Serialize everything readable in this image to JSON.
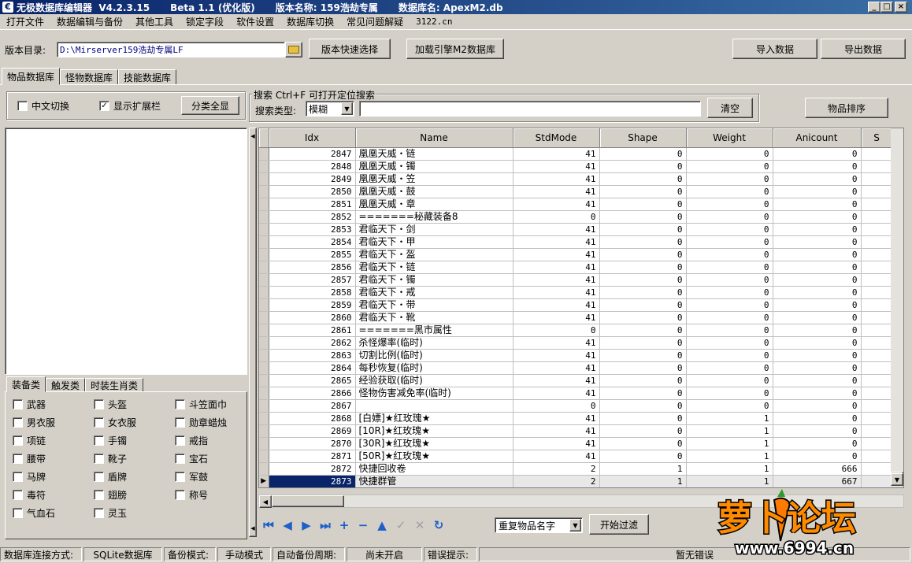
{
  "window": {
    "app_title": "无极数据库编辑器",
    "version": "V4.2.3.15",
    "beta": "Beta 1.1 (优化版)",
    "edition_label": "版本名称: 159浩劫专属",
    "db_label": "数据库名: ApexM2.db",
    "min": "_",
    "max": "□",
    "close": "×"
  },
  "menu": [
    "打开文件",
    "数据编辑与备份",
    "其他工具",
    "锁定字段",
    "软件设置",
    "数据库切换",
    "常见问题解疑",
    "3122.cn"
  ],
  "toolbar": {
    "dir_label": "版本目录:",
    "dir_value": "D:\\Mirserver159浩劫专属LF",
    "quick_select": "版本快速选择",
    "load_engine": "加载引擎M2数据库",
    "import": "导入数据",
    "export": "导出数据"
  },
  "main_tabs": [
    "物品数据库",
    "怪物数据库",
    "技能数据库"
  ],
  "options": {
    "chinese_switch": "中文切换",
    "show_ext": "显示扩展栏",
    "show_all": "分类全显"
  },
  "search": {
    "group_title": "搜索  Ctrl+F 可打开定位搜索",
    "type_label": "搜索类型:",
    "type_value": "模糊",
    "clear": "清空",
    "sort": "物品排序"
  },
  "category_tabs": [
    "装备类",
    "触发类",
    "时装生肖类"
  ],
  "categories": [
    [
      "武器",
      "头盔",
      "斗笠面巾"
    ],
    [
      "男衣服",
      "女衣服",
      "勋章蜡烛"
    ],
    [
      "项链",
      "手镯",
      "戒指"
    ],
    [
      "腰带",
      "靴子",
      "宝石"
    ],
    [
      "马牌",
      "盾牌",
      "军鼓"
    ],
    [
      "毒符",
      "翅膀",
      "称号"
    ],
    [
      "气血石",
      "灵玉",
      ""
    ]
  ],
  "grid": {
    "columns": [
      "Idx",
      "Name",
      "StdMode",
      "Shape",
      "Weight",
      "Anicount",
      "S"
    ],
    "rows": [
      [
        "2847",
        "凰凰天威・链",
        "41",
        "0",
        "0",
        "0"
      ],
      [
        "2848",
        "凰凰天威・镯",
        "41",
        "0",
        "0",
        "0"
      ],
      [
        "2849",
        "凰凰天威・笠",
        "41",
        "0",
        "0",
        "0"
      ],
      [
        "2850",
        "凰凰天威・鼓",
        "41",
        "0",
        "0",
        "0"
      ],
      [
        "2851",
        "凰凰天威・章",
        "41",
        "0",
        "0",
        "0"
      ],
      [
        "2852",
        "=======秘藏装备8",
        "0",
        "0",
        "0",
        "0"
      ],
      [
        "2853",
        "君临天下・剑",
        "41",
        "0",
        "0",
        "0"
      ],
      [
        "2854",
        "君临天下・甲",
        "41",
        "0",
        "0",
        "0"
      ],
      [
        "2855",
        "君临天下・盔",
        "41",
        "0",
        "0",
        "0"
      ],
      [
        "2856",
        "君临天下・链",
        "41",
        "0",
        "0",
        "0"
      ],
      [
        "2857",
        "君临天下・镯",
        "41",
        "0",
        "0",
        "0"
      ],
      [
        "2858",
        "君临天下・戒",
        "41",
        "0",
        "0",
        "0"
      ],
      [
        "2859",
        "君临天下・带",
        "41",
        "0",
        "0",
        "0"
      ],
      [
        "2860",
        "君临天下・靴",
        "41",
        "0",
        "0",
        "0"
      ],
      [
        "2861",
        "=======黑市属性",
        "0",
        "0",
        "0",
        "0"
      ],
      [
        "2862",
        "杀怪爆率(临时)",
        "41",
        "0",
        "0",
        "0"
      ],
      [
        "2863",
        "切割比例(临时)",
        "41",
        "0",
        "0",
        "0"
      ],
      [
        "2864",
        "每秒恢复(临时)",
        "41",
        "0",
        "0",
        "0"
      ],
      [
        "2865",
        "经验获取(临时)",
        "41",
        "0",
        "0",
        "0"
      ],
      [
        "2866",
        "怪物伤害减免率(临时)",
        "41",
        "0",
        "0",
        "0"
      ],
      [
        "2867",
        "",
        "0",
        "0",
        "0",
        "0"
      ],
      [
        "2868",
        "[白嫖]★红玫瑰★",
        "41",
        "0",
        "1",
        "0"
      ],
      [
        "2869",
        "[10R]★红玫瑰★",
        "41",
        "0",
        "1",
        "0"
      ],
      [
        "2870",
        "[30R]★红玫瑰★",
        "41",
        "0",
        "1",
        "0"
      ],
      [
        "2871",
        "[50R]★红玫瑰★",
        "41",
        "0",
        "1",
        "0"
      ],
      [
        "2872",
        "快捷回收卷",
        "2",
        "1",
        "1",
        "666"
      ],
      [
        "2873",
        "快捷群管",
        "2",
        "1",
        "1",
        "667"
      ]
    ],
    "selected_index": 26
  },
  "bottom": {
    "filter_select": "重复物品名字",
    "start_filter": "开始过滤"
  },
  "status": {
    "conn_label": "数据库连接方式:",
    "conn_value": "SQLite数据库",
    "backup_label": "备份模式:",
    "backup_value": "手动模式",
    "auto_label": "自动备份周期:",
    "auto_value": "尚未开启",
    "err_label": "错误提示:",
    "err_value": "暂无错误"
  },
  "watermark": {
    "logo_text": "萝卜论坛",
    "url": "www.6994.cn",
    "color": "#ff8a00"
  }
}
